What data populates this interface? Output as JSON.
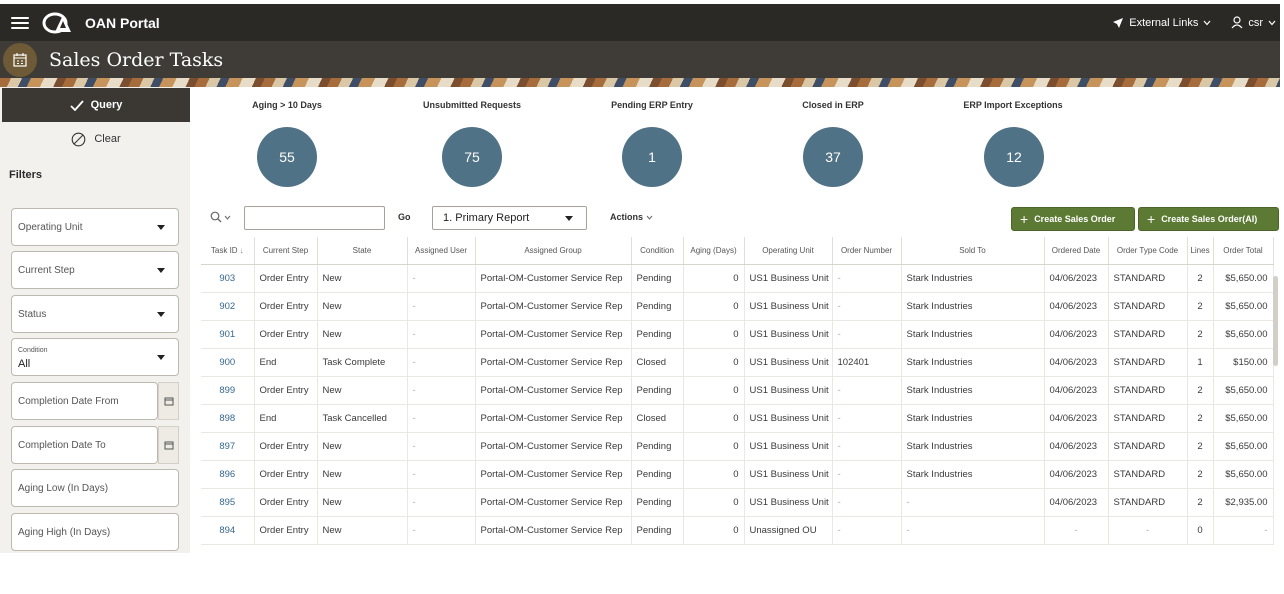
{
  "header": {
    "app_title": "OAN Portal",
    "external_links": "External Links",
    "user": "csr",
    "page_title": "Sales Order Tasks"
  },
  "left": {
    "query_label": "Query",
    "clear_label": "Clear",
    "filters_label": "Filters",
    "operating_unit": "Operating Unit",
    "current_step": "Current Step",
    "status": "Status",
    "condition_label": "Condition",
    "condition_value": "All",
    "completion_from": "Completion Date From",
    "completion_to": "Completion Date To",
    "aging_low": "Aging Low (In Days)",
    "aging_high": "Aging High (In Days)"
  },
  "kpis": [
    {
      "label": "Aging > 10 Days",
      "value": "55"
    },
    {
      "label": "Unsubmitted Requests",
      "value": "75"
    },
    {
      "label": "Pending ERP Entry",
      "value": "1"
    },
    {
      "label": "Closed in ERP",
      "value": "37"
    },
    {
      "label": "ERP Import Exceptions",
      "value": "12"
    }
  ],
  "toolbar": {
    "go": "Go",
    "report": "1. Primary Report",
    "actions": "Actions",
    "create_order": "Create Sales Order",
    "create_order_ai": "Create Sales Order(AI)"
  },
  "colors": {
    "topbar": "#2b2926",
    "kpi_circle": "#4f7286",
    "green_button": "#5c7a34",
    "link": "#36678e"
  },
  "table": {
    "columns": [
      "Task ID",
      "Current Step",
      "State",
      "Assigned User",
      "Assigned Group",
      "Condition",
      "Aging (Days)",
      "Operating Unit",
      "Order Number",
      "Sold To",
      "Ordered Date",
      "Order Type Code",
      "Lines",
      "Order Total"
    ],
    "rows": [
      [
        "903",
        "Order Entry",
        "New",
        "-",
        "Portal-OM-Customer Service Rep",
        "Pending",
        "0",
        "US1 Business Unit",
        "-",
        "Stark Industries",
        "04/06/2023",
        "STANDARD",
        "2",
        "$5,650.00"
      ],
      [
        "902",
        "Order Entry",
        "New",
        "-",
        "Portal-OM-Customer Service Rep",
        "Pending",
        "0",
        "US1 Business Unit",
        "-",
        "Stark Industries",
        "04/06/2023",
        "STANDARD",
        "2",
        "$5,650.00"
      ],
      [
        "901",
        "Order Entry",
        "New",
        "-",
        "Portal-OM-Customer Service Rep",
        "Pending",
        "0",
        "US1 Business Unit",
        "-",
        "Stark Industries",
        "04/06/2023",
        "STANDARD",
        "2",
        "$5,650.00"
      ],
      [
        "900",
        "End",
        "Task Complete",
        "-",
        "Portal-OM-Customer Service Rep",
        "Closed",
        "0",
        "US1 Business Unit",
        "102401",
        "Stark Industries",
        "04/06/2023",
        "STANDARD",
        "1",
        "$150.00"
      ],
      [
        "899",
        "Order Entry",
        "New",
        "-",
        "Portal-OM-Customer Service Rep",
        "Pending",
        "0",
        "US1 Business Unit",
        "-",
        "Stark Industries",
        "04/06/2023",
        "STANDARD",
        "2",
        "$5,650.00"
      ],
      [
        "898",
        "End",
        "Task Cancelled",
        "-",
        "Portal-OM-Customer Service Rep",
        "Closed",
        "0",
        "US1 Business Unit",
        "-",
        "Stark Industries",
        "04/06/2023",
        "STANDARD",
        "2",
        "$5,650.00"
      ],
      [
        "897",
        "Order Entry",
        "New",
        "-",
        "Portal-OM-Customer Service Rep",
        "Pending",
        "0",
        "US1 Business Unit",
        "-",
        "Stark Industries",
        "04/06/2023",
        "STANDARD",
        "2",
        "$5,650.00"
      ],
      [
        "896",
        "Order Entry",
        "New",
        "-",
        "Portal-OM-Customer Service Rep",
        "Pending",
        "0",
        "US1 Business Unit",
        "-",
        "Stark Industries",
        "04/06/2023",
        "STANDARD",
        "2",
        "$5,650.00"
      ],
      [
        "895",
        "Order Entry",
        "New",
        "-",
        "Portal-OM-Customer Service Rep",
        "Pending",
        "0",
        "US1 Business Unit",
        "-",
        "-",
        "04/06/2023",
        "STANDARD",
        "2",
        "$2,935.00"
      ],
      [
        "894",
        "Order Entry",
        "New",
        "-",
        "Portal-OM-Customer Service Rep",
        "Pending",
        "0",
        "Unassigned OU",
        "-",
        "-",
        "-",
        "-",
        "0",
        "-"
      ]
    ]
  }
}
